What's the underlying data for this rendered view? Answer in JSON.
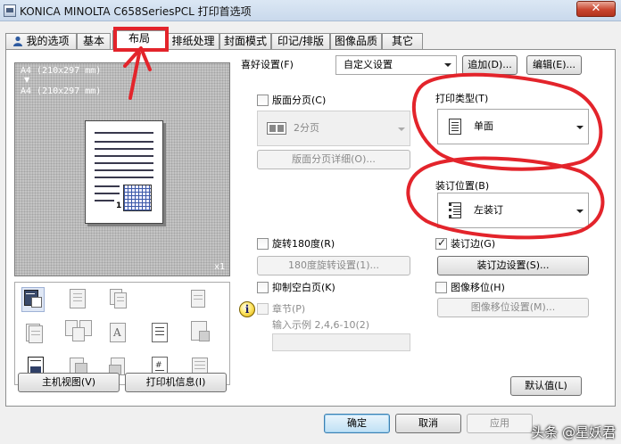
{
  "window": {
    "title": "KONICA MINOLTA C658SeriesPCL 打印首选项",
    "close_glyph": "✕"
  },
  "tabs": [
    {
      "label": "我的选项"
    },
    {
      "label": "基本"
    },
    {
      "label": "布局",
      "active": true
    },
    {
      "label": "排纸处理"
    },
    {
      "label": "封面模式"
    },
    {
      "label": "印记/排版"
    },
    {
      "label": "图像品质"
    },
    {
      "label": "其它"
    }
  ],
  "preview": {
    "line1": "A4 (210x297 mm)",
    "arrow": "▼",
    "line2": "A4 (210x297 mm)",
    "zoom": "x1",
    "page_number": "1"
  },
  "left_buttons": {
    "host_view": "主机视图(V)",
    "printer_info": "打印机信息(I)"
  },
  "favorite": {
    "label": "喜好设置(F)",
    "value": "自定义设置",
    "add": "追加(D)...",
    "edit": "编辑(E)..."
  },
  "layout": {
    "combine_label": "版面分页(C)",
    "combine_checked": false,
    "combine_value": "2分页",
    "combine_details": "版面分页详细(O)...",
    "rotate_label": "旋转180度(R)",
    "rotate_checked": false,
    "rotate_settings": "180度旋转设置(1)...",
    "skip_blank_label": "抑制空白页(K)",
    "skip_blank_checked": false,
    "chapter_label": "章节(P)",
    "chapter_checked": false,
    "chapter_hint": "输入示例 2,4,6-10(2)",
    "chapter_input": ""
  },
  "print_type": {
    "label": "打印类型(T)",
    "value": "单面"
  },
  "binding_position": {
    "label": "装订位置(B)",
    "value": "左装订"
  },
  "binding_margin": {
    "label": "装订边(G)",
    "checked": true,
    "settings": "装订边设置(S)..."
  },
  "image_shift": {
    "label": "图像移位(H)",
    "checked": false,
    "settings": "图像移位设置(M)..."
  },
  "defaults_button": "默认值(L)",
  "footer": {
    "ok": "确定",
    "cancel": "取消",
    "apply": "应用"
  },
  "watermark": "头条 @星妖君",
  "colors": {
    "annotation_red": "#e3242b",
    "title_bar": "#c9d9ec",
    "close_button": "#c9452f"
  }
}
